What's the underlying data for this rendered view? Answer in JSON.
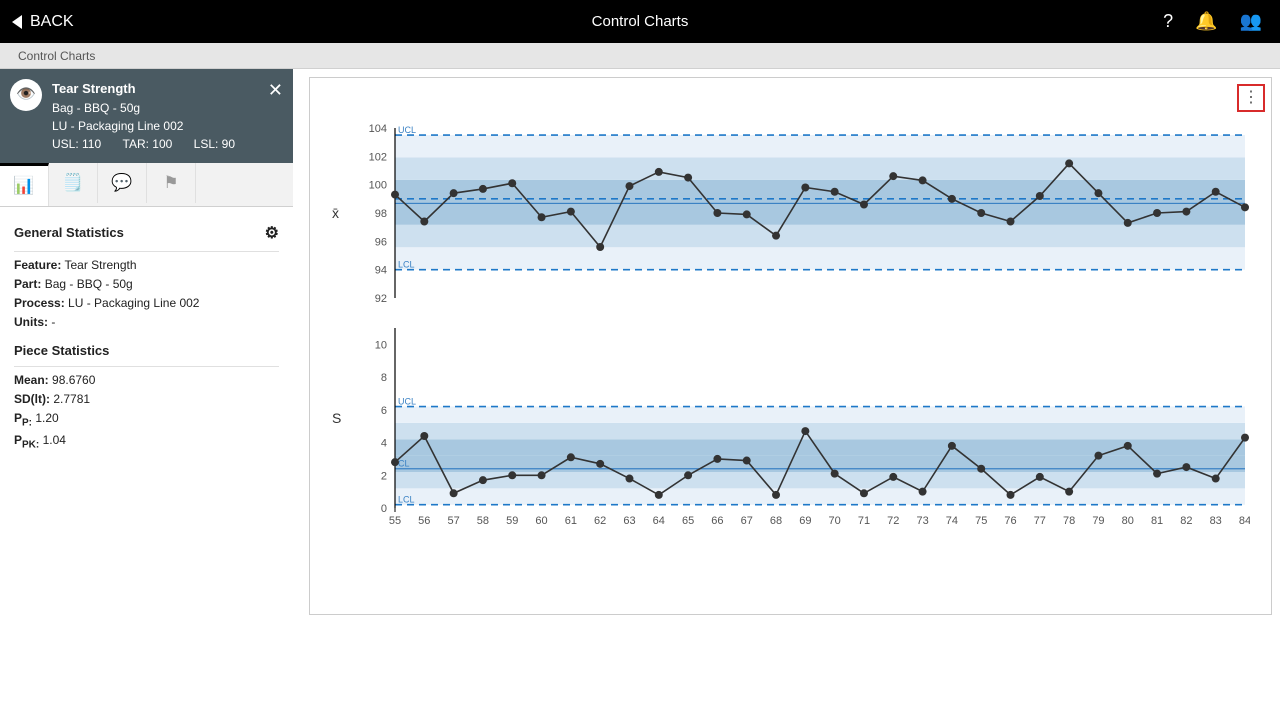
{
  "header": {
    "back_label": "BACK",
    "title": "Control Charts"
  },
  "breadcrumb": "Control Charts",
  "feature": {
    "title": "Tear Strength",
    "part": "Bag - BBQ - 50g",
    "process": "LU - Packaging Line 002",
    "usl_label": "USL: 110",
    "tar_label": "TAR: 100",
    "lsl_label": "LSL: 90"
  },
  "stats": {
    "section1_title": "General Statistics",
    "feature_lbl": "Feature:",
    "feature_val": "Tear Strength",
    "part_lbl": "Part:",
    "part_val": "Bag - BBQ - 50g",
    "process_lbl": "Process:",
    "process_val": "LU - Packaging Line 002",
    "units_lbl": "Units:",
    "units_val": "-",
    "section2_title": "Piece Statistics",
    "mean_lbl": "Mean:",
    "mean_val": "98.6760",
    "sd_lbl": "SD(lt):",
    "sd_val": "2.7781",
    "pp_lbl": "P",
    "pp_sub": "P:",
    "pp_val": "1.20",
    "ppk_lbl": "P",
    "ppk_sub": "PK:",
    "ppk_val": "1.04"
  },
  "chart_data": [
    {
      "type": "line",
      "name": "Xbar",
      "axis_label": "x̄",
      "ylim": [
        92,
        104
      ],
      "yticks": [
        92,
        94,
        96,
        98,
        100,
        102,
        104
      ],
      "center_line": 98.68,
      "ucl": 103.5,
      "ucl_label": "UCL",
      "lcl": 94.0,
      "lcl_label": "LCL",
      "cl2": 99.0,
      "x": [
        55,
        56,
        57,
        58,
        59,
        60,
        61,
        62,
        63,
        64,
        65,
        66,
        67,
        68,
        69,
        70,
        71,
        72,
        73,
        74,
        75,
        76,
        77,
        78,
        79,
        80,
        81,
        82,
        83,
        84
      ],
      "values": [
        99.3,
        97.4,
        99.4,
        99.7,
        100.1,
        97.7,
        98.1,
        95.6,
        99.9,
        100.9,
        100.5,
        98.0,
        97.9,
        96.4,
        99.8,
        99.5,
        98.6,
        100.6,
        100.3,
        99.0,
        98.0,
        97.4,
        99.2,
        101.5,
        99.4,
        97.3,
        98.0,
        98.1,
        99.5,
        98.4
      ]
    },
    {
      "type": "line",
      "name": "S",
      "axis_label": "S",
      "ylim": [
        0,
        11
      ],
      "yticks": [
        0,
        2,
        4,
        6,
        8,
        10
      ],
      "center_line": 2.4,
      "ucl": 6.2,
      "ucl_label": "UCL",
      "lcl": 0.2,
      "lcl_label": "LCL",
      "cl2_label": "CL",
      "x": [
        55,
        56,
        57,
        58,
        59,
        60,
        61,
        62,
        63,
        64,
        65,
        66,
        67,
        68,
        69,
        70,
        71,
        72,
        73,
        74,
        75,
        76,
        77,
        78,
        79,
        80,
        81,
        82,
        83,
        84
      ],
      "values": [
        2.8,
        4.4,
        0.9,
        1.7,
        2.0,
        2.0,
        3.1,
        2.7,
        1.8,
        0.8,
        2.0,
        3.0,
        2.9,
        0.8,
        4.7,
        2.1,
        0.9,
        1.9,
        1.0,
        3.8,
        2.4,
        0.8,
        1.9,
        1.0,
        3.2,
        3.8,
        2.1,
        2.5,
        1.8,
        4.3
      ]
    }
  ]
}
